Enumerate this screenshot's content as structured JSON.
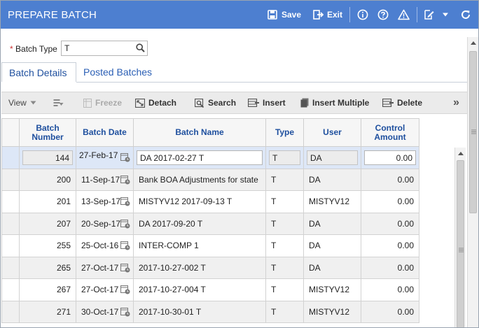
{
  "window": {
    "title": "PREPARE BATCH",
    "accent_color": "#4d7fd0"
  },
  "titlebar": {
    "save_label": "Save",
    "exit_label": "Exit",
    "icons": [
      "save-icon",
      "exit-icon",
      "info-icon",
      "help-icon",
      "warning-icon",
      "edit-icon",
      "dropdown-icon",
      "refresh-icon"
    ]
  },
  "filter": {
    "batch_type_label": "Batch Type",
    "required_marker": "*",
    "batch_type_value": "T"
  },
  "tabs": [
    {
      "label": "Batch Details",
      "active": true
    },
    {
      "label": "Posted Batches",
      "active": false
    }
  ],
  "toolbar": {
    "view_label": "View",
    "freeze_label": "Freeze",
    "detach_label": "Detach",
    "search_label": "Search",
    "insert_label": "Insert",
    "insert_multiple_label": "Insert Multiple",
    "delete_label": "Delete",
    "more_label": "»"
  },
  "grid": {
    "columns": [
      "Batch Number",
      "Batch Date",
      "Batch Name",
      "Type",
      "User",
      "Control Amount"
    ],
    "column_lines": {
      "batch_number": [
        "Batch",
        "Number"
      ],
      "control_amount": [
        "Control",
        "Amount"
      ]
    },
    "rows": [
      {
        "batch_number": "144",
        "batch_date": "27-Feb-17",
        "batch_name": "DA 2017-02-27 T",
        "type": "T",
        "user": "DA",
        "control_amount": "0.00",
        "editing": true
      },
      {
        "batch_number": "200",
        "batch_date": "11-Sep-17",
        "batch_name": "Bank BOA Adjustments for state",
        "type": "T",
        "user": "DA",
        "control_amount": "0.00"
      },
      {
        "batch_number": "201",
        "batch_date": "13-Sep-17",
        "batch_name": "MISTYV12 2017-09-13 T",
        "type": "T",
        "user": "MISTYV12",
        "control_amount": "0.00"
      },
      {
        "batch_number": "207",
        "batch_date": "20-Sep-17",
        "batch_name": "DA 2017-09-20 T",
        "type": "T",
        "user": "DA",
        "control_amount": "0.00"
      },
      {
        "batch_number": "255",
        "batch_date": "25-Oct-16",
        "batch_name": "INTER-COMP 1",
        "type": "T",
        "user": "DA",
        "control_amount": "0.00"
      },
      {
        "batch_number": "265",
        "batch_date": "27-Oct-17",
        "batch_name": "2017-10-27-002 T",
        "type": "T",
        "user": "DA",
        "control_amount": "0.00"
      },
      {
        "batch_number": "267",
        "batch_date": "27-Oct-17",
        "batch_name": "2017-10-27-004 T",
        "type": "T",
        "user": "MISTYV12",
        "control_amount": "0.00"
      },
      {
        "batch_number": "271",
        "batch_date": "30-Oct-17",
        "batch_name": "2017-10-30-01 T",
        "type": "T",
        "user": "MISTYV12",
        "control_amount": "0.00"
      }
    ]
  }
}
